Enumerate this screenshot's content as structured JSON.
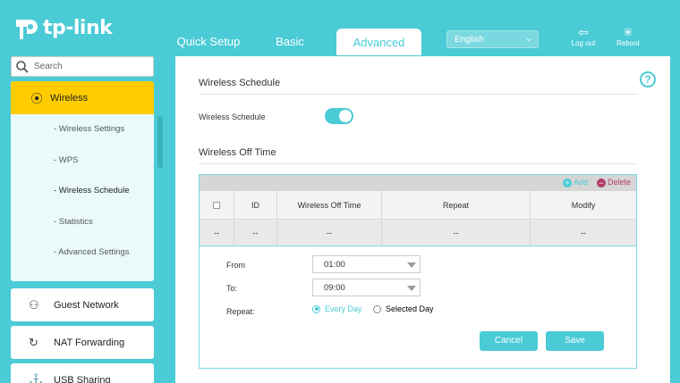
{
  "brand": {
    "name": "tp-link",
    "accent": "#4acbd6",
    "highlight": "#ffcc00"
  },
  "header": {
    "tabs": [
      {
        "label": "Quick Setup"
      },
      {
        "label": "Basic"
      },
      {
        "label": "Advanced",
        "active": true
      }
    ],
    "language": "English",
    "logout_label": "Log out",
    "reboot_label": "Reboot"
  },
  "sidebar": {
    "search_placeholder": "Search",
    "active_item": "Wireless",
    "sub_items": [
      "- Wireless Settings",
      "- WPS",
      "- Wireless Schedule",
      "- Statistics",
      "- Advanced Settings"
    ],
    "items": [
      {
        "label": "Guest Network",
        "icon": "guest-network-icon"
      },
      {
        "label": "NAT Forwarding",
        "icon": "nat-forwarding-icon"
      },
      {
        "label": "USB Sharing",
        "icon": "usb-icon"
      }
    ]
  },
  "main": {
    "section1_title": "Wireless Schedule",
    "schedule_label": "Wireless Schedule",
    "schedule_enabled": true,
    "section2_title": "Wireless Off Time",
    "add_label": "Add",
    "delete_label": "Delete",
    "table": {
      "columns": [
        "ID",
        "Wireless Off Time",
        "Repeat",
        "Modify"
      ],
      "row": [
        "--",
        "--",
        "--",
        "--",
        "--"
      ]
    },
    "form": {
      "from_label": "From",
      "from_value": "01:00",
      "to_label": "To:",
      "to_value": "09:00",
      "repeat_label": "Repeat:",
      "repeat_options": [
        "Every Day",
        "Selected Day"
      ],
      "repeat_selected": "Every Day",
      "cancel_label": "Cancel",
      "save_label": "Save"
    }
  }
}
